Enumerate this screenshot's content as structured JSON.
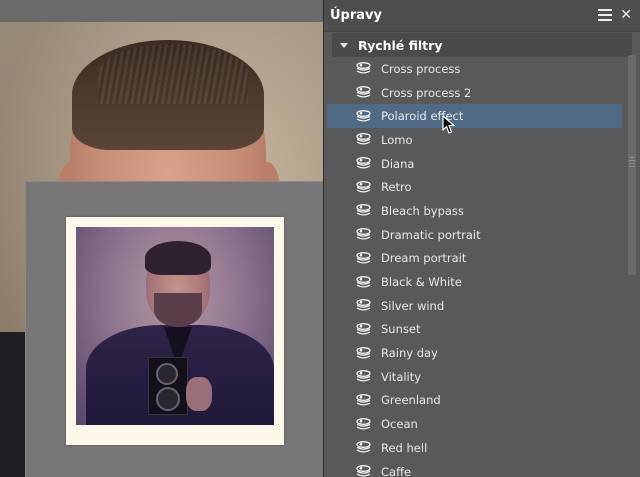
{
  "panel": {
    "title": "Úpravy",
    "group": {
      "label": "Rychlé filtry",
      "items": [
        {
          "label": "Cross process"
        },
        {
          "label": "Cross process 2"
        },
        {
          "label": "Polaroid effect",
          "selected": true
        },
        {
          "label": "Lomo"
        },
        {
          "label": "Diana"
        },
        {
          "label": "Retro"
        },
        {
          "label": "Bleach bypass"
        },
        {
          "label": "Dramatic portrait"
        },
        {
          "label": "Dream portrait"
        },
        {
          "label": "Black & White"
        },
        {
          "label": "Silver wind"
        },
        {
          "label": "Sunset"
        },
        {
          "label": "Rainy day"
        },
        {
          "label": "Vitality"
        },
        {
          "label": "Greenland"
        },
        {
          "label": "Ocean"
        },
        {
          "label": "Red hell"
        },
        {
          "label": "Caffe"
        }
      ]
    }
  },
  "colors": {
    "selected_row": "#4f6a85",
    "panel_bg": "#595959",
    "polaroid_frame": "#fbf8ea"
  },
  "icons": {
    "filter_item": "stacked-layers-icon",
    "menu": "hamburger-menu-icon",
    "close": "close-icon",
    "expand": "caret-down-icon"
  }
}
